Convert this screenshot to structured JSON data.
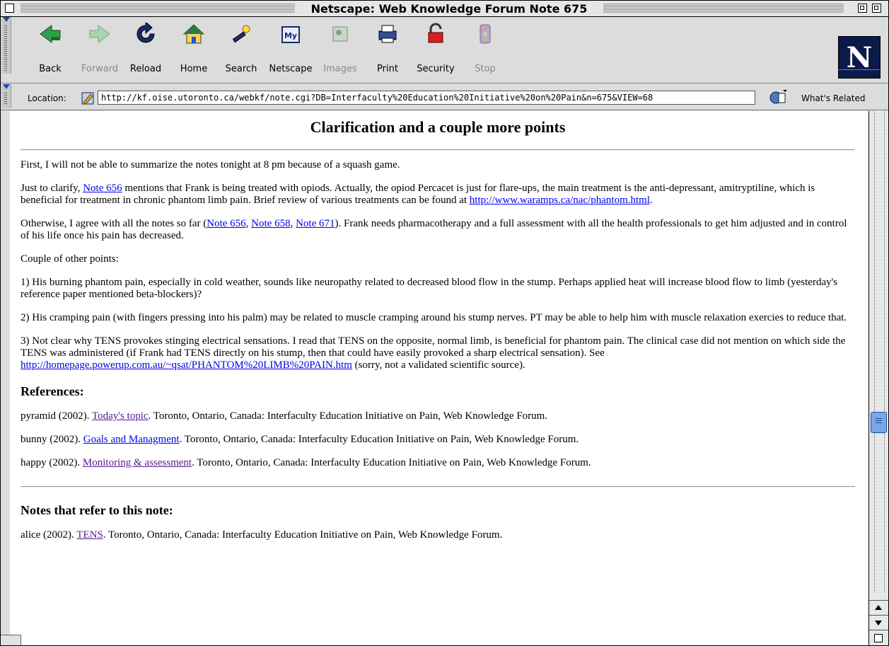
{
  "window": {
    "title": "Netscape: Web Knowledge Forum Note 675"
  },
  "toolbar": {
    "buttons": [
      {
        "label": "Back",
        "icon": "back-arrow-icon",
        "enabled": true
      },
      {
        "label": "Forward",
        "icon": "forward-arrow-icon",
        "enabled": false
      },
      {
        "label": "Reload",
        "icon": "reload-icon",
        "enabled": true
      },
      {
        "label": "Home",
        "icon": "home-icon",
        "enabled": true
      },
      {
        "label": "Search",
        "icon": "search-icon",
        "enabled": true
      },
      {
        "label": "Netscape",
        "icon": "netscape-icon",
        "enabled": true
      },
      {
        "label": "Images",
        "icon": "images-icon",
        "enabled": false
      },
      {
        "label": "Print",
        "icon": "print-icon",
        "enabled": true
      },
      {
        "label": "Security",
        "icon": "security-lock-icon",
        "enabled": true
      },
      {
        "label": "Stop",
        "icon": "stop-icon",
        "enabled": false
      }
    ],
    "logo_letter": "N"
  },
  "location": {
    "label": "Location:",
    "url": "http://kf.oise.utoronto.ca/webkf/note.cgi?DB=Interfaculty%20Education%20Initiative%20on%20Pain&n=675&VIEW=68",
    "related_label": "What's Related"
  },
  "page": {
    "title": "Clarification and a couple more points",
    "p1": "First, I will not be able to summarize the notes tonight at 8 pm because of a squash game.",
    "p2_a": "Just to clarify, ",
    "p2_link1": "Note 656",
    "p2_b": " mentions that Frank is being treated with opiods. Actually, the opiod Percacet is just for flare-ups, the main treatment is the anti-depressant, amitryptiline, which is beneficial for treatment in chronic phantom limb pain. Brief review of various treatments can be found at ",
    "p2_link2": "http://www.waramps.ca/nac/phantom.html",
    "p2_c": ".",
    "p3_a": "Otherwise, I agree with all the notes so far (",
    "p3_link1": "Note 656",
    "p3_sep1": ", ",
    "p3_link2": "Note 658",
    "p3_sep2": ", ",
    "p3_link3": "Note 671",
    "p3_b": "). Frank needs pharmacotherapy and a full assessment with all the health professionals to get him adjusted and in control of his life once his pain has decreased.",
    "p4": "Couple of other points:",
    "p5": "1) His burning phantom pain, especially in cold weather, sounds like neuropathy related to decreased blood flow in the stump. Perhaps applied heat will increase blood flow to limb (yesterday's reference paper mentioned beta-blockers)?",
    "p6": "2) His cramping pain (with fingers pressing into his palm) may be related to muscle cramping around his stump nerves. PT may be able to help him with muscle relaxation exercies to reduce that.",
    "p7_a": "3) Not clear why TENS provokes stinging electrical sensations. I read that TENS on the opposite, normal limb, is beneficial for phantom pain. The clinical case did not mention on which side the TENS was administered (if Frank had TENS directly on his stump, then that could have easily provoked a sharp electrical sensation). See ",
    "p7_link": "http://homepage.powerup.com.au/~qsat/PHANTOM%20LIMB%20PAIN.htm",
    "p7_b": " (sorry, not a validated scientific source).",
    "references_heading": "References:",
    "references": [
      {
        "prefix": "pyramid (2002). ",
        "link": "Today's topic",
        "suffix": ". Toronto, Ontario, Canada: Interfaculty Education Initiative on Pain, Web Knowledge Forum."
      },
      {
        "prefix": "bunny (2002). ",
        "link": "Goals and Managment",
        "suffix": ". Toronto, Ontario, Canada: Interfaculty Education Initiative on Pain, Web Knowledge Forum."
      },
      {
        "prefix": "happy (2002). ",
        "link": "Monitoring & assessment",
        "suffix": ". Toronto, Ontario, Canada: Interfaculty Education Initiative on Pain, Web Knowledge Forum."
      }
    ],
    "referrers_heading": "Notes that refer to this note:",
    "referrers": [
      {
        "prefix": "alice (2002). ",
        "link": "TENS",
        "suffix": ". Toronto, Ontario, Canada: Interfaculty Education Initiative on Pain, Web Knowledge Forum."
      }
    ]
  },
  "colors": {
    "link": "#0000ee",
    "visited_link": "#551a8b",
    "scroll_thumb": "#7aa6e6"
  }
}
